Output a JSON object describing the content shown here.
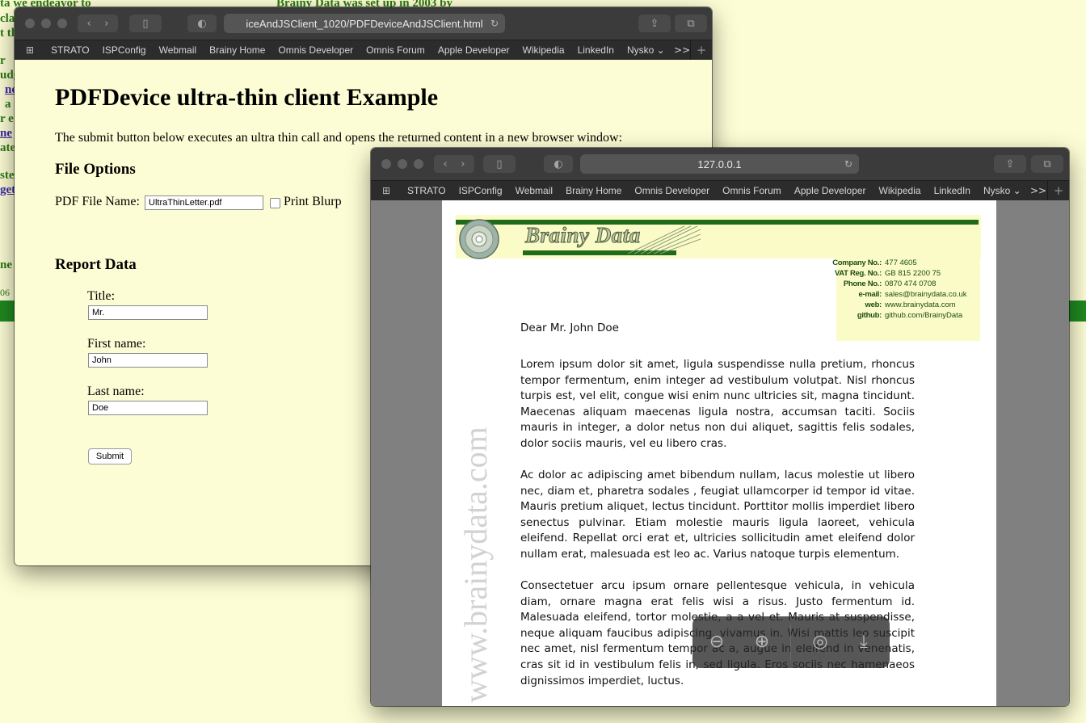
{
  "background_page": {
    "fragments": [
      "ta   we   endeavor   to",
      "Brainy  Data  was  set  up  in  2003  by",
      "cla",
      "t th",
      "r",
      "udg",
      "ne",
      "a",
      "r e",
      "ne",
      "ate",
      "ste",
      "get",
      "ne",
      "06"
    ]
  },
  "window1": {
    "url": "iceAndJSClient_1020/PDFDeviceAndJSClient.html",
    "bookmarks": [
      "STRATO",
      "ISPConfig",
      "Webmail",
      "Brainy Home",
      "Omnis Developer",
      "Omnis Forum",
      "Apple Developer",
      "Wikipedia",
      "LinkedIn",
      "Nysko ⌄"
    ],
    "more": ">>",
    "heading": "PDFDevice ultra-thin client Example",
    "intro": "The submit button below executes an ultra thin call and opens the returned content in a new browser window:",
    "file_options": {
      "heading": "File Options",
      "pdf_label": "PDF File Name:",
      "pdf_value": "UltraThinLetter.pdf",
      "print_label": "Print Blurp"
    },
    "report": {
      "heading": "Report Data",
      "title_label": "Title:",
      "title_value": "Mr.",
      "first_label": "First name:",
      "first_value": "John",
      "last_label": "Last name:",
      "last_value": "Doe",
      "submit": "Submit"
    }
  },
  "window2": {
    "url": "127.0.0.1",
    "bookmarks": [
      "STRATO",
      "ISPConfig",
      "Webmail",
      "Brainy Home",
      "Omnis Developer",
      "Omnis Forum",
      "Apple Developer",
      "Wikipedia",
      "LinkedIn",
      "Nysko ⌄"
    ],
    "more": ">>",
    "letterhead": {
      "brand": "Brainy Data",
      "details": [
        {
          "key": "Company No.:",
          "value": "477 4605"
        },
        {
          "key": "VAT Reg. No.:",
          "value": "GB 815 2200 75"
        },
        {
          "key": "Phone No.:",
          "value": "0870 474 0708"
        },
        {
          "key": "e-mail:",
          "value": "sales@brainydata.co.uk"
        },
        {
          "key": "web:",
          "value": "www.brainydata.com"
        },
        {
          "key": "github:",
          "value": "github.com/BrainyData"
        }
      ]
    },
    "salutation": "Dear Mr. John Doe",
    "paragraphs": [
      "Lorem ipsum dolor sit amet, ligula suspendisse nulla pretium, rhoncus tempor fermentum, enim integer ad vestibulum volutpat. Nisl rhoncus turpis est, vel elit, congue wisi enim nunc ultricies sit, magna tincidunt. Maecenas aliquam maecenas ligula nostra, accumsan taciti. Sociis mauris in integer, a dolor netus non dui aliquet, sagittis felis sodales, dolor sociis mauris, vel eu libero cras.",
      "Ac dolor ac adipiscing amet bibendum nullam, lacus molestie ut libero nec, diam et, pharetra sodales , feugiat ullamcorper id tempor id vitae. Mauris pretium aliquet, lectus tincidunt. Porttitor mollis imperdiet libero senectus pulvinar. Etiam molestie mauris ligula laoreet, vehicula eleifend. Repellat orci erat et, ultricies sollicitudin amet eleifend dolor nullam erat, malesuada est leo ac. Varius natoque turpis elementum.",
      "Consectetuer arcu ipsum ornare pellentesque vehicula, in vehicula diam, ornare magna erat felis wisi a risus. Justo fermentum id. Malesuada eleifend, tortor molestie, a a vel et. Mauris at suspendisse, neque aliquam faucibus adipiscing, vivamus in. Wisi mattis leo suscipit nec amet, nisl fermentum tempor ac a, augue in eleifend in venenatis, cras sit id in vestibulum felis in, sed ligula. Eros sociis nec hamenaeos dignissimos imperdiet, luctus."
    ],
    "watermark": "www.brainydata.com"
  }
}
